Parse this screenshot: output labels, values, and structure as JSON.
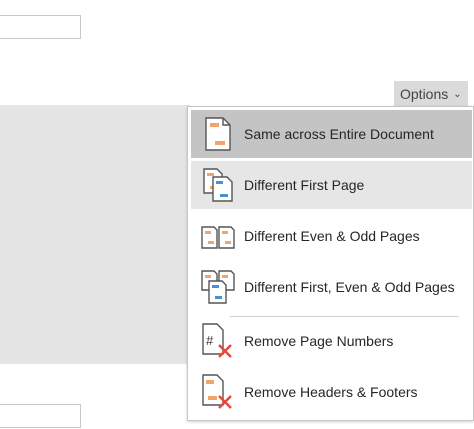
{
  "options": {
    "label": "Options",
    "chevron": "chevron-down-icon"
  },
  "menu": {
    "items": [
      {
        "label": "Same across Entire Document",
        "icon": "same-across-document-icon"
      },
      {
        "label": "Different First Page",
        "icon": "different-first-page-icon"
      },
      {
        "label": "Different Even & Odd Pages",
        "icon": "even-odd-pages-icon"
      },
      {
        "label": "Different First, Even & Odd Pages",
        "icon": "first-even-odd-pages-icon"
      },
      {
        "label": "Remove Page Numbers",
        "icon": "remove-page-numbers-icon"
      },
      {
        "label": "Remove Headers & Footers",
        "icon": "remove-headers-footers-icon"
      }
    ]
  },
  "colors": {
    "accent_orange": "#f3a46b",
    "accent_blue": "#4a90d9",
    "remove_red": "#e8463a"
  }
}
